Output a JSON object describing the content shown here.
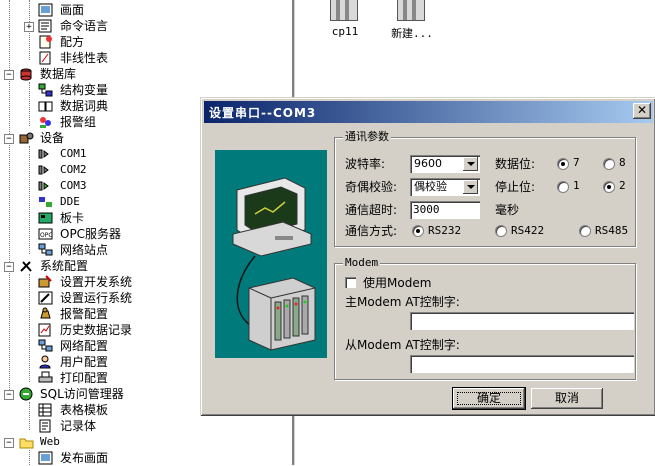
{
  "tree": {
    "items": [
      {
        "label": "画面",
        "icon": "screen-icon"
      },
      {
        "label": "命令语言",
        "icon": "command-icon"
      },
      {
        "label": "配方",
        "icon": "recipe-icon"
      },
      {
        "label": "非线性表",
        "icon": "table-icon"
      },
      {
        "label": "数据库",
        "icon": "database-icon"
      },
      {
        "label": "结构变量",
        "icon": "struct-icon"
      },
      {
        "label": "数据词典",
        "icon": "dictionary-icon"
      },
      {
        "label": "报警组",
        "icon": "alarm-group-icon"
      },
      {
        "label": "设备",
        "icon": "device-icon"
      },
      {
        "label": "COM1",
        "icon": "com-port-icon"
      },
      {
        "label": "COM2",
        "icon": "com-port-icon"
      },
      {
        "label": "COM3",
        "icon": "com-port-icon"
      },
      {
        "label": "DDE",
        "icon": "dde-icon"
      },
      {
        "label": "板卡",
        "icon": "board-icon"
      },
      {
        "label": "OPC服务器",
        "icon": "opc-icon"
      },
      {
        "label": "网络站点",
        "icon": "network-icon"
      },
      {
        "label": "系统配置",
        "icon": "tools-icon"
      },
      {
        "label": "设置开发系统",
        "icon": "dev-system-icon"
      },
      {
        "label": "设置运行系统",
        "icon": "run-system-icon"
      },
      {
        "label": "报警配置",
        "icon": "alarm-icon"
      },
      {
        "label": "历史数据记录",
        "icon": "history-icon"
      },
      {
        "label": "网络配置",
        "icon": "network-config-icon"
      },
      {
        "label": "用户配置",
        "icon": "user-icon"
      },
      {
        "label": "打印配置",
        "icon": "printer-icon"
      },
      {
        "label": "SQL访问管理器",
        "icon": "sql-icon"
      },
      {
        "label": "表格模板",
        "icon": "table-template-icon"
      },
      {
        "label": "记录体",
        "icon": "record-icon"
      },
      {
        "label": "Web",
        "icon": "folder-icon"
      },
      {
        "label": "发布画面",
        "icon": "publish-icon"
      }
    ]
  },
  "files": [
    {
      "label": "cp11"
    },
    {
      "label": "新建..."
    }
  ],
  "dialog": {
    "title": "设置串口--COM3",
    "close_glyph": "✕",
    "comm": {
      "legend": "通讯参数",
      "baud_label": "波特率:",
      "baud_value": "9600",
      "parity_label": "奇偶校验:",
      "parity_value": "偶校验",
      "timeout_label": "通信超时:",
      "timeout_value": "3000",
      "timeout_unit": "毫秒",
      "databits_label": "数据位:",
      "databits_options": [
        "7",
        "8"
      ],
      "databits_selected": "7",
      "stopbits_label": "停止位:",
      "stopbits_options": [
        "1",
        "2"
      ],
      "stopbits_selected": "2",
      "mode_label": "通信方式:",
      "mode_options": [
        "RS232",
        "RS422",
        "RS485"
      ],
      "mode_selected": "RS232"
    },
    "modem": {
      "legend": "Modem",
      "use_modem_label": "使用Modem",
      "use_modem_checked": false,
      "master_label": "主Modem AT控制字:",
      "master_value": "",
      "slave_label": "从Modem AT控制字:",
      "slave_value": ""
    },
    "ok_label": "确定",
    "cancel_label": "取消"
  },
  "colors": {
    "title_start": "#0a246a",
    "title_end": "#a6caf0",
    "picture_bg": "#007a7a",
    "dialog_face": "#d4d0c8",
    "close_button": "#d4d0c8"
  }
}
